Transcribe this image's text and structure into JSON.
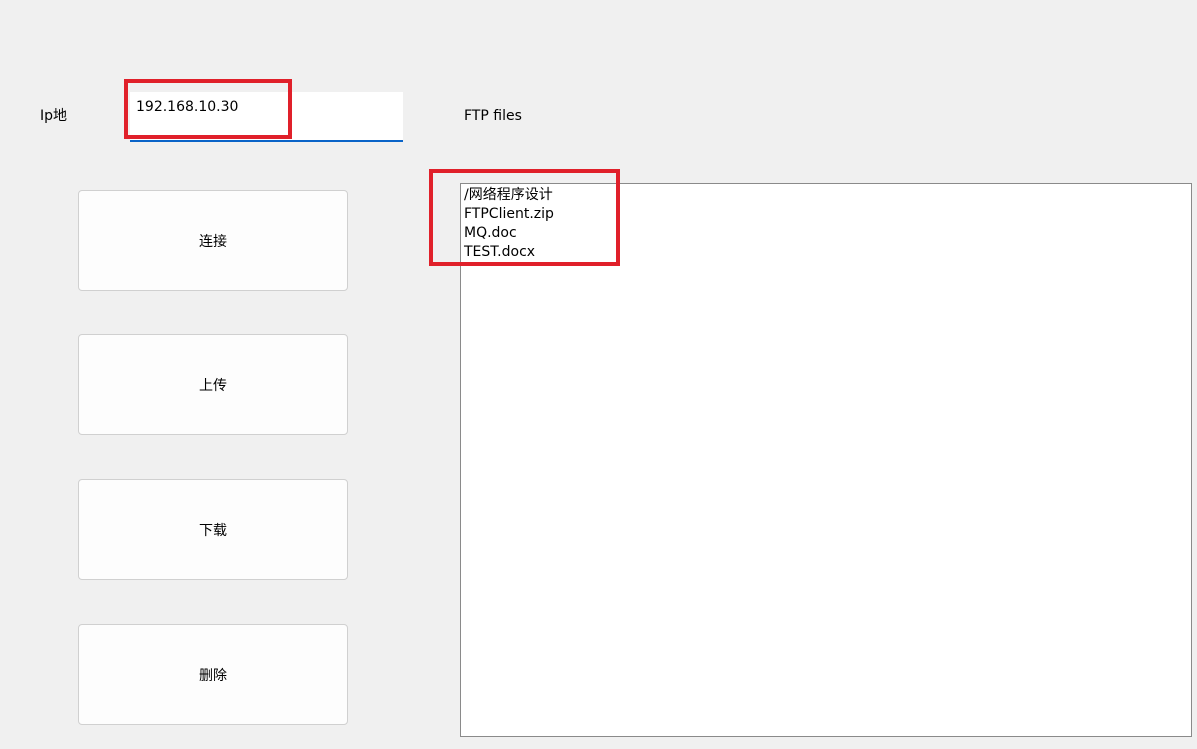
{
  "form": {
    "ip_label": "Ip地",
    "ip_value": "192.168.10.30"
  },
  "buttons": {
    "connect": "连接",
    "upload": "上传",
    "download": "下载",
    "delete": "删除"
  },
  "files": {
    "label": "FTP files",
    "items": [
      "/网络程序设计",
      "FTPClient.zip",
      "MQ.doc",
      "TEST.docx"
    ]
  },
  "colors": {
    "background": "#f0f0f0",
    "input_underline": "#0a64c8",
    "highlight_box": "#e0202a"
  }
}
